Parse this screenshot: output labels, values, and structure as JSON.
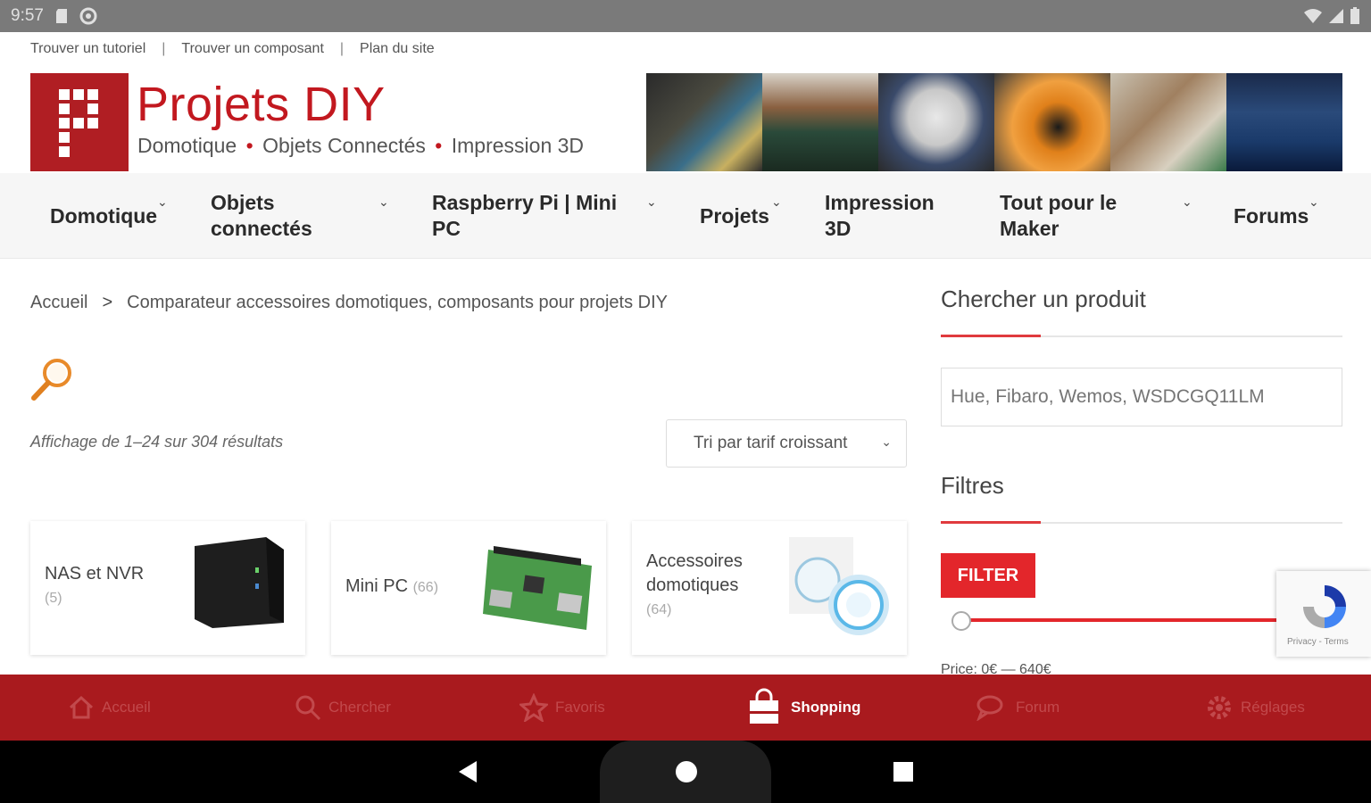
{
  "status_bar": {
    "time": "9:57"
  },
  "top_links": [
    "Trouver un tutoriel",
    "Trouver un composant",
    "Plan du site"
  ],
  "header": {
    "title": "Projets DIY",
    "subtitle_parts": [
      "Domotique",
      "Objets Connectés",
      "Impression 3D"
    ]
  },
  "nav": {
    "items": [
      {
        "label": "Domotique"
      },
      {
        "label": "Objets connectés"
      },
      {
        "label": "Raspberry Pi | Mini PC"
      },
      {
        "label": "Projets"
      },
      {
        "label": "Impression 3D"
      },
      {
        "label": "Tout pour le Maker"
      },
      {
        "label": "Forums"
      }
    ]
  },
  "breadcrumb": {
    "home": "Accueil",
    "separator": ">",
    "current": "Comparateur accessoires domotiques, composants pour projets DIY"
  },
  "results_text": "Affichage de 1–24 sur 304 résultats",
  "sort": {
    "selected": "Tri par tarif croissant"
  },
  "categories": [
    {
      "name": "NAS et NVR",
      "count": "(5)"
    },
    {
      "name": "Mini PC",
      "count": "(66)"
    },
    {
      "name": "Accessoires domotiques",
      "count": "(64)"
    }
  ],
  "sidebar": {
    "search_title": "Chercher un produit",
    "search_placeholder": "Hue, Fibaro, Wemos, WSDCGQ11LM",
    "filters_title": "Filtres",
    "filter_button": "FILTER",
    "price_text": "Price: 0€ — 640€"
  },
  "recaptcha": {
    "terms": "Privacy - Terms"
  },
  "tabbar": {
    "tabs": [
      {
        "label": "Accueil",
        "icon": "home-icon"
      },
      {
        "label": "Chercher",
        "icon": "search-icon"
      },
      {
        "label": "Favoris",
        "icon": "star-icon"
      },
      {
        "label": "Shopping",
        "icon": "shopping-bag-icon",
        "active": true
      },
      {
        "label": "Forum",
        "icon": "chat-icon"
      },
      {
        "label": "Réglages",
        "icon": "gear-icon"
      }
    ]
  },
  "colors": {
    "brand_red": "#c2181f",
    "tabbar": "#a91a1e",
    "accent": "#e3262b"
  }
}
